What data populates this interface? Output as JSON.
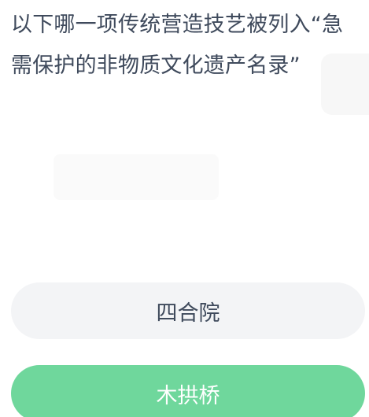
{
  "quiz": {
    "question": "以下哪一项传统营造技艺被列入“急需保护的非物质文化遗产名录”",
    "options": [
      {
        "label": "四合院",
        "state": "default"
      },
      {
        "label": "木拱桥",
        "state": "selected"
      }
    ]
  },
  "colors": {
    "question_text": "#3f4a5c",
    "option_default_bg": "#f3f4f6",
    "option_selected_bg": "#6fd79c",
    "option_selected_text": "#ffffff"
  }
}
